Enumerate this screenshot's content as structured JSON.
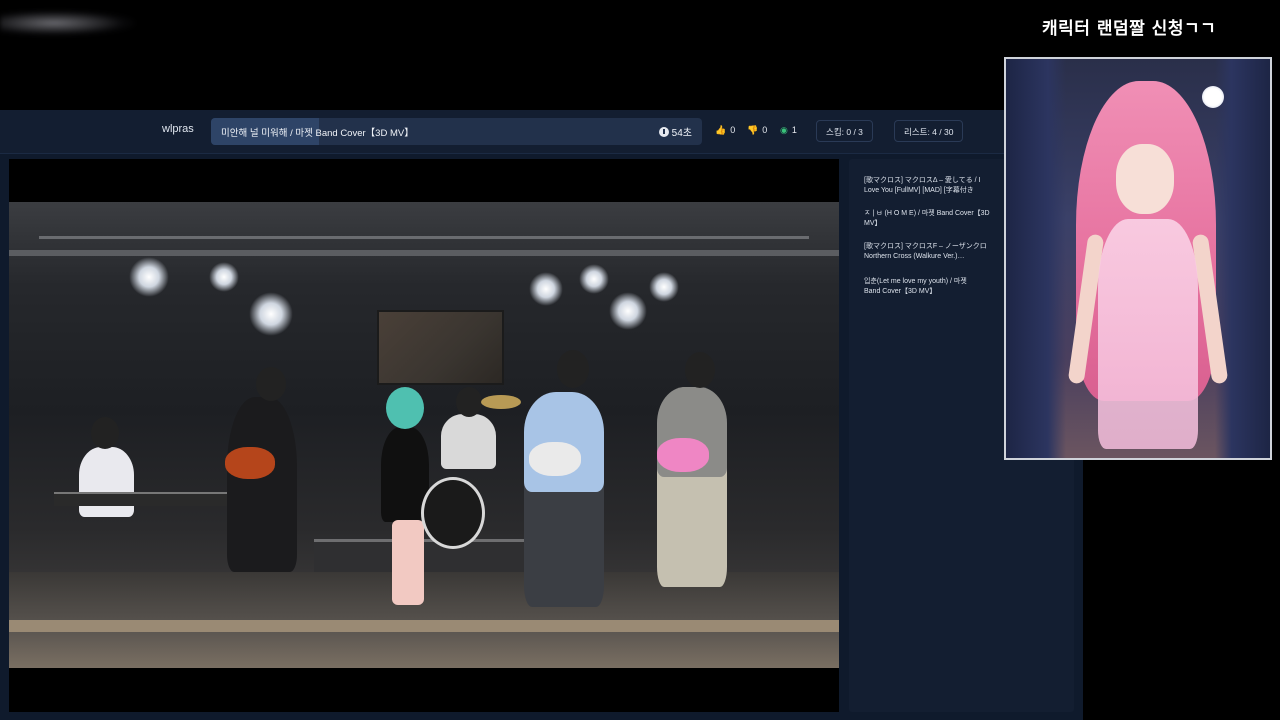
{
  "overlay": {
    "title": "캐릭터 랜덤짤 신청ㄱㄱ"
  },
  "player": {
    "username": "wlpras",
    "song_title": "미안해 널 미워해 / 마젯 Band Cover【3D MV】",
    "progress_fraction": 0.22,
    "time_remaining": "54초",
    "likes": "0",
    "dislikes": "0",
    "views": "1",
    "skip_label": "스킵: 0 / 3",
    "list_label": "리스트: 4 / 30"
  },
  "icons": {
    "clock": "clock-icon",
    "like": "thumbs-up-icon",
    "dislike": "thumbs-down-icon",
    "view": "eye-icon"
  },
  "colors": {
    "panel_bg": "#0f1a2c",
    "header_bg": "#131e31",
    "song_box": "#22314b",
    "like": "#4a90e2",
    "dislike": "#e05a5a",
    "view": "#39c27a"
  },
  "playlist": [
    "[歌マクロス] マクロスΔ – 愛してる / I\nLove You [FullMV] [MAD] [字幕付き",
    "ㅈ | ㅂ (H O M E) / 마젯 Band Cover【3D\nMV】",
    "[歌マクロス] マクロスF – ノーザンクロ\nNorthern Cross (Walkure Ver.)…",
    "입춘(Let me love my youth) / 마젯\nBand Cover【3D MV】"
  ]
}
